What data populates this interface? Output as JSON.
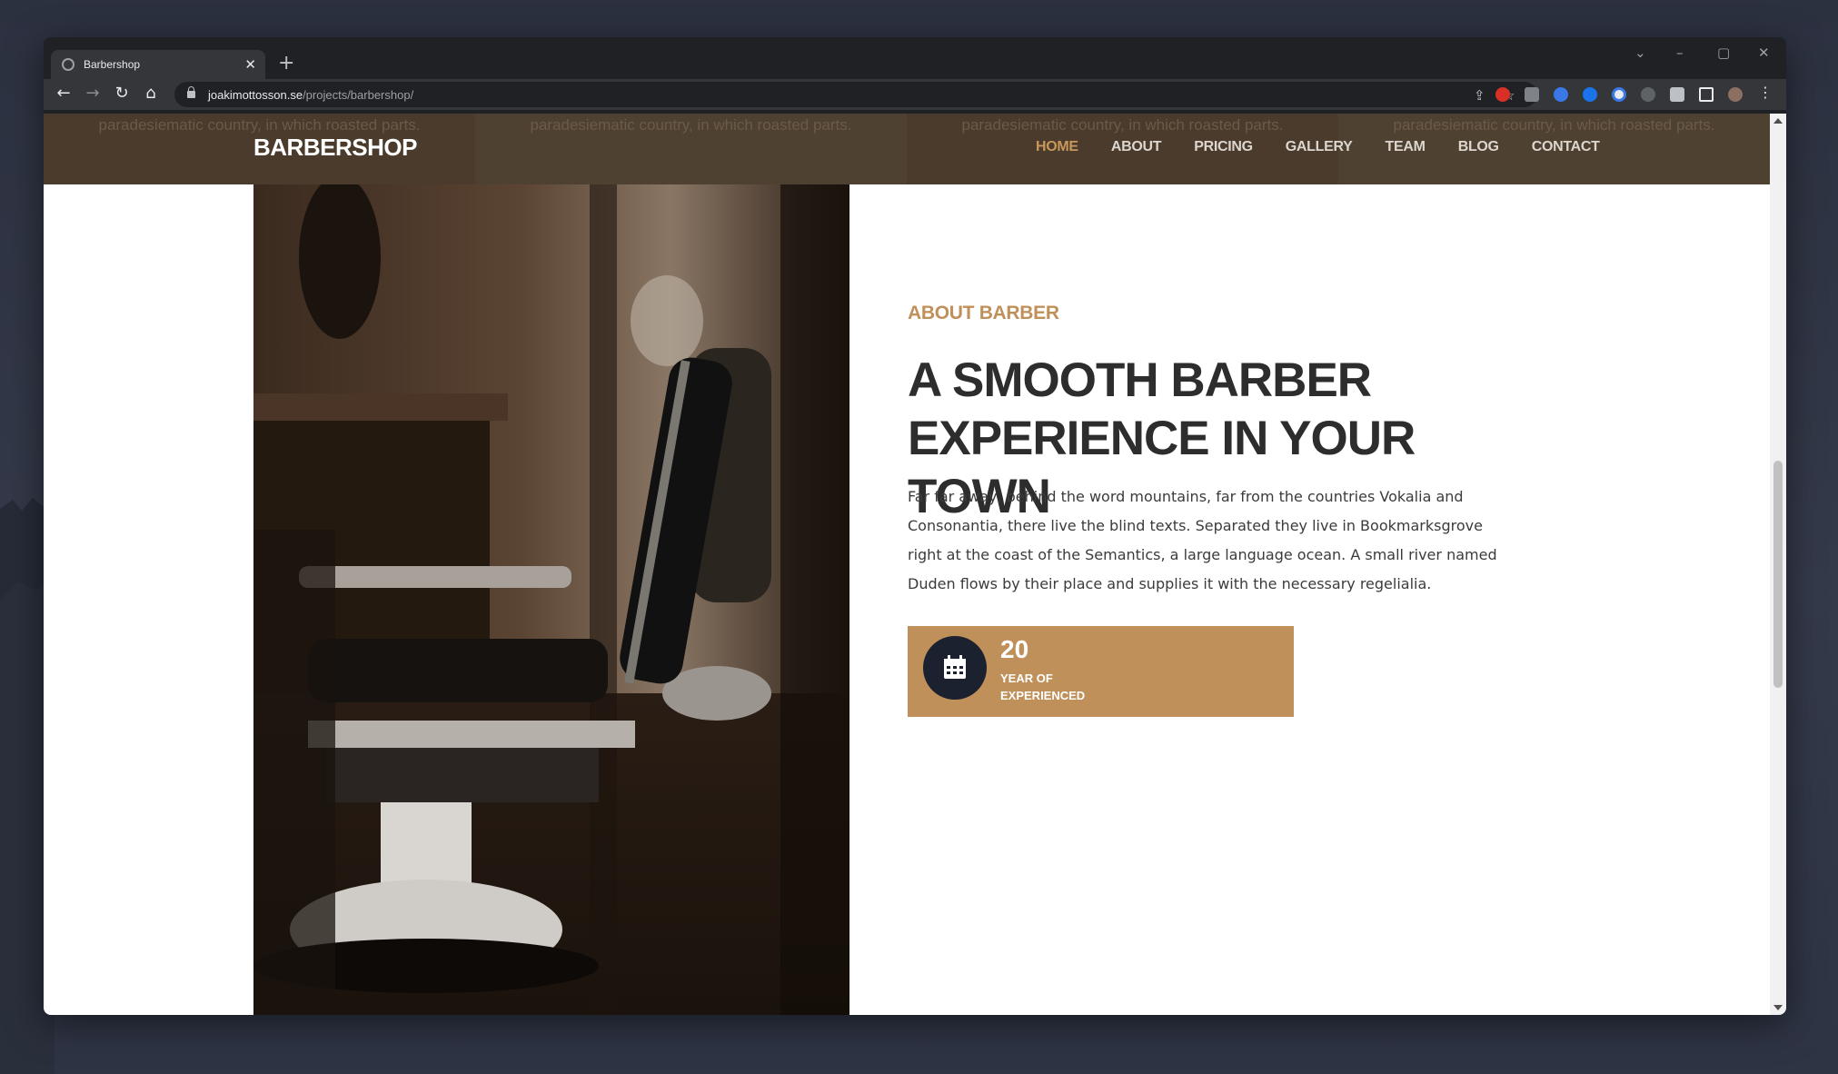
{
  "browser": {
    "tab_title": "Barbershop",
    "new_tab_label": "+",
    "url_host": "joakimottosson.se",
    "url_path": "/projects/barbershop/",
    "window_controls": [
      "⌄",
      "–",
      "▢",
      "✕"
    ]
  },
  "site": {
    "top_strip_text": "paradesiematic country, in which roasted parts.",
    "brand": "BARBERSHOP",
    "nav": [
      {
        "label": "HOME",
        "active": true
      },
      {
        "label": "ABOUT",
        "active": false
      },
      {
        "label": "PRICING",
        "active": false
      },
      {
        "label": "GALLERY",
        "active": false
      },
      {
        "label": "TEAM",
        "active": false
      },
      {
        "label": "BLOG",
        "active": false
      },
      {
        "label": "CONTACT",
        "active": false
      }
    ]
  },
  "about": {
    "eyebrow": "ABOUT BARBER",
    "headline": "A SMOOTH BARBER EXPERIENCE IN YOUR TOWN",
    "paragraph": "Far far away, behind the word mountains, far from the countries Vokalia and Consonantia, there live the blind texts. Separated they live in Bookmarksgrove right at the coast of the Semantics, a large language ocean. A small river named Duden flows by their place and supplies it with the necessary regelialia.",
    "stat": {
      "number": "20",
      "label": "YEAR OF EXPERIENCED",
      "icon": "calendar-icon"
    }
  },
  "colors": {
    "header_bg": "#4a3b2c",
    "accent": "#c0905a",
    "nav_active": "#c8975b",
    "icon_circle": "#1c2130"
  }
}
